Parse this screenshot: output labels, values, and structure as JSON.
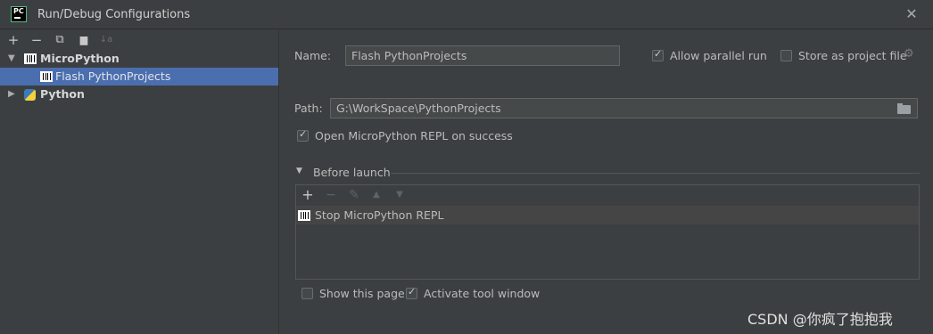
{
  "window": {
    "title": "Run/Debug Configurations",
    "app_icon_text": "PC",
    "close_glyph": "✕"
  },
  "toolbar": {
    "add_glyph": "+",
    "remove_glyph": "−",
    "copy_glyph": "⧉",
    "folder_glyph": "▆",
    "sort_glyph": "↓a"
  },
  "tree": {
    "groups": [
      {
        "label": "MicroPython",
        "expanded": true,
        "icon": "micropython-icon"
      },
      {
        "label": "Python",
        "expanded": false,
        "icon": "python-icon"
      }
    ],
    "child": {
      "label": "Flash PythonProjects",
      "icon": "micropython-icon",
      "selected": true
    },
    "expanded_arrow": "▼",
    "collapsed_arrow": "▶"
  },
  "form": {
    "name_label": "Name:",
    "name_value": "Flash PythonProjects",
    "allow_parallel_label": "Allow parallel run",
    "allow_parallel_checked": true,
    "store_project_label": "Store as project file",
    "store_project_checked": false,
    "path_label": "Path:",
    "path_value": "G:\\WorkSpace\\PythonProjects",
    "open_repl_label": "Open MicroPython REPL on success",
    "open_repl_checked": true
  },
  "before_launch": {
    "title": "Before launch",
    "toggle_glyph": "▼",
    "add_glyph": "+",
    "remove_glyph": "−",
    "edit_glyph": "✎",
    "up_glyph": "▲",
    "down_glyph": "▼",
    "tasks": [
      "Stop MicroPython REPL"
    ]
  },
  "footer": {
    "show_page_label": "Show this page",
    "show_page_checked": false,
    "activate_tool_label": "Activate tool window",
    "activate_tool_checked": true
  },
  "watermark": "CSDN @你疯了抱抱我",
  "colors": {
    "background": "#3c3f41",
    "selection": "#4b6eaf",
    "field_bg": "#45494a"
  }
}
